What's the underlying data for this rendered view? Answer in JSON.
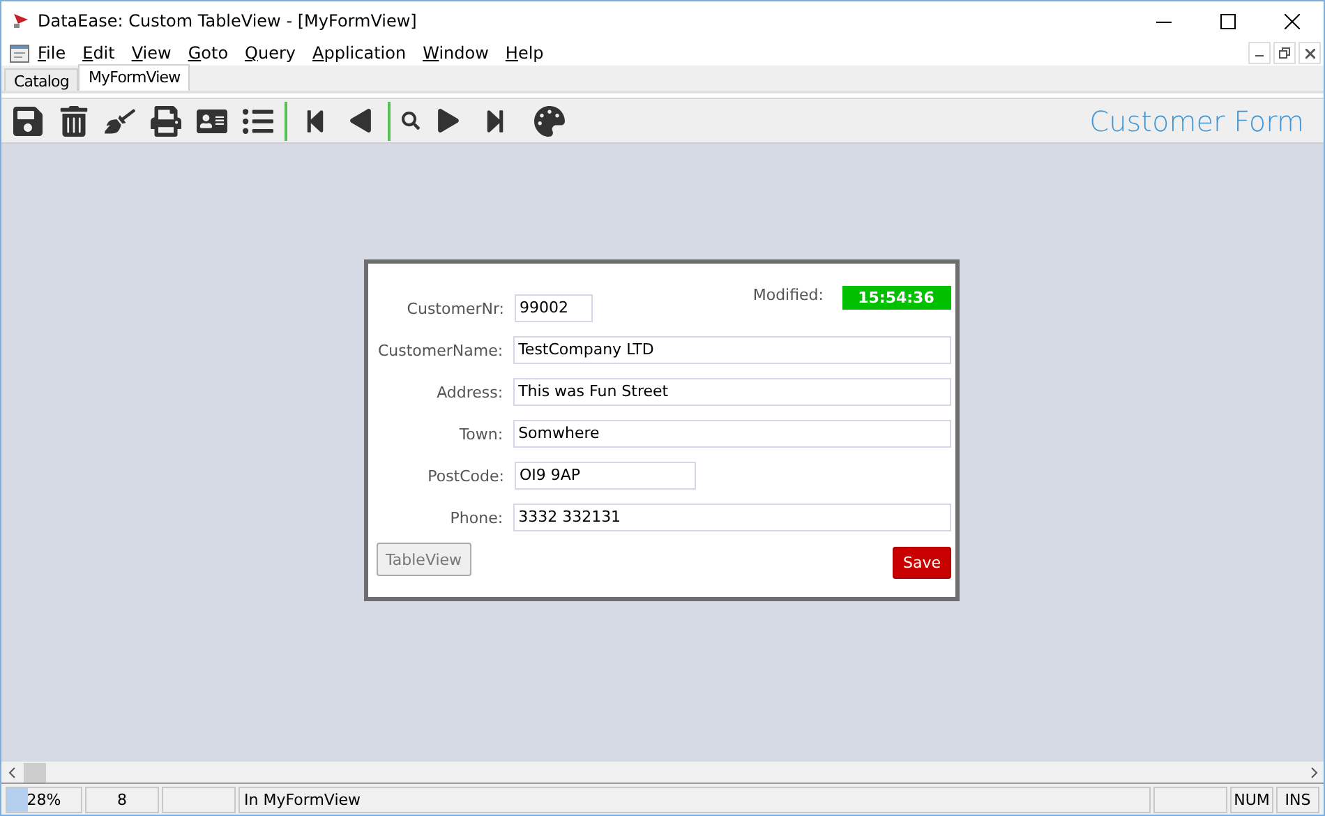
{
  "window": {
    "title": "DataEase: Custom TableView - [MyFormView]"
  },
  "menu": [
    "File",
    "Edit",
    "View",
    "Goto",
    "Query",
    "Application",
    "Window",
    "Help"
  ],
  "tabs": [
    {
      "label": "Catalog",
      "selected": false
    },
    {
      "label": "MyFormView",
      "selected": true
    }
  ],
  "toolbar": {
    "title": "Customer Form"
  },
  "form": {
    "modified_label": "Modified:",
    "modified_value": "15:54:36",
    "fields": [
      {
        "label": "CustomerNr:",
        "value": "99002",
        "kind": "short"
      },
      {
        "label": "CustomerName:",
        "value": "TestCompany LTD",
        "kind": "long"
      },
      {
        "label": "Address:",
        "value": "This was Fun Street",
        "kind": "long"
      },
      {
        "label": "Town:",
        "value": "Somwhere",
        "kind": "long"
      },
      {
        "label": "PostCode:",
        "value": "OI9 9AP",
        "kind": "medium"
      },
      {
        "label": "Phone:",
        "value": "3332 332131",
        "kind": "long"
      }
    ],
    "buttons": [
      {
        "label": "TableView",
        "kind": "secondary"
      },
      {
        "label": "Save",
        "kind": "primary"
      }
    ]
  },
  "status_bar": {
    "progress": {
      "reading": "28%",
      "level": 0.28
    },
    "cells": [
      {
        "text": "8",
        "kind": "narrow"
      },
      {
        "text": "",
        "kind": "narrow"
      },
      {
        "text": "In MyFormView",
        "kind": "wide"
      },
      {
        "text": "",
        "kind": "narrow"
      },
      {
        "text": "NUM",
        "kind": "key"
      },
      {
        "text": "INS",
        "kind": "key"
      }
    ]
  }
}
